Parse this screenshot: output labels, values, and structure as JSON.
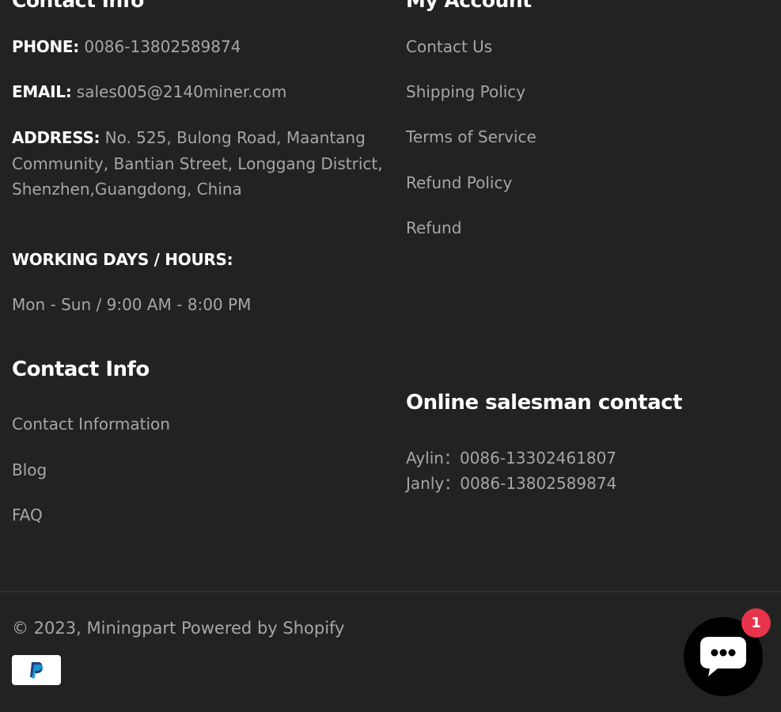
{
  "left_column": {
    "heading_cut": "Contact Info",
    "phone_label": "PHONE:",
    "phone_value": "0086-13802589874",
    "email_label": "EMAIL:",
    "email_value": "sales005@2140miner.com",
    "address_label": "ADDRESS:",
    "address_value": "No. 525, Bulong Road, Maantang Community, Bantian Street, Longgang District, Shenzhen,Guangdong, China",
    "hours_label": "WORKING DAYS / HOURS:",
    "hours_value": "Mon - Sun / 9:00 AM - 8:00 PM"
  },
  "right_column": {
    "heading_cut": "My Account",
    "links": [
      "Contact Us",
      "Shipping Policy",
      "Terms of Service",
      "Refund Policy",
      "Refund"
    ]
  },
  "contact_info": {
    "title": "Contact Info",
    "links": [
      "Contact Information",
      "Blog",
      "FAQ"
    ]
  },
  "salesman": {
    "title": "Online salesman contact",
    "lines": [
      "Aylin：0086-13302461807",
      "Janly：0086-13802589874"
    ]
  },
  "footer": {
    "copyright_prefix": "© 2023,",
    "store_name": "Miningpart",
    "powered_by": "Powered by Shopify",
    "payment_icon": "paypal-icon"
  },
  "chat": {
    "icon": "chat-bubble-icon",
    "badge_count": "1"
  },
  "colors": {
    "background": "#222222",
    "text_muted": "#a6a6a6",
    "text_white": "#ffffff",
    "badge": "#e8344a"
  }
}
